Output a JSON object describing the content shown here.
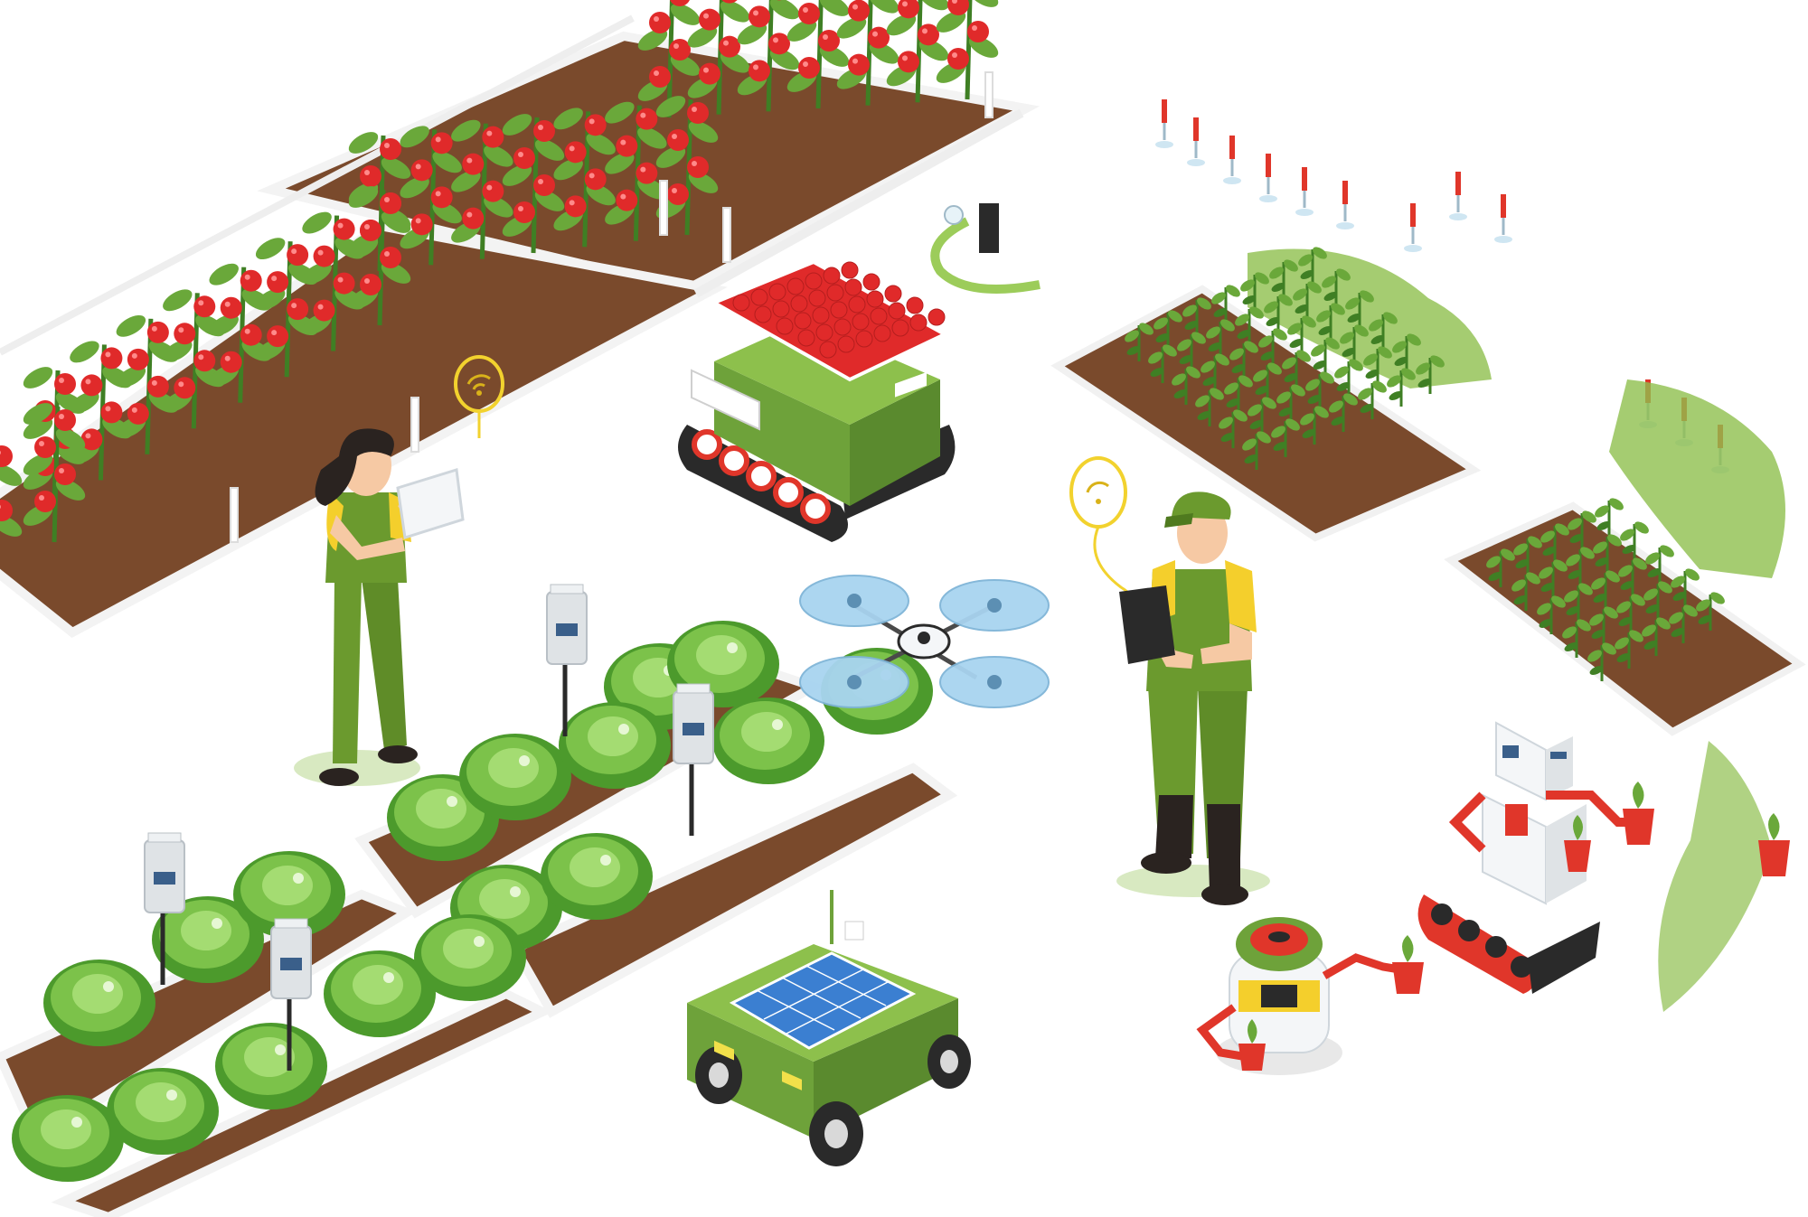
{
  "scene": {
    "subject": "smart-farming-isometric",
    "background_color": "#ffffff"
  },
  "palette": {
    "soil": "#7a4a2c",
    "soil_dark": "#5e3620",
    "bed_edge": "#f3f3f3",
    "leaf": "#6aa83a",
    "leaf_dark": "#3f7f24",
    "tomato": "#e02a2a",
    "tomato_hi": "#ff8a8a",
    "cabbage": "#7cc24a",
    "cabbage_dark": "#4c9a2c",
    "uniform": "#6b9a2e",
    "uniform_dark": "#4f7a1f",
    "shirt": "#f4cf2c",
    "skin": "#f6c9a4",
    "hair": "#2a2320",
    "machine_green": "#6ea23a",
    "machine_dark": "#3c5f1d",
    "robot_red": "#e0362a",
    "robot_white": "#f4f6f8",
    "drone_blue": "#a8d4f0",
    "solar_blue": "#3b7fd1",
    "wifi": "#f2d22e",
    "sensor_gray": "#dfe3e6",
    "sensor_screen": "#3a5f8a"
  },
  "elements": [
    {
      "name": "tomato-greenhouse-beds",
      "icon": "tomato-plant-icon"
    },
    {
      "name": "cabbage-beds-with-sensors",
      "icon": "cabbage-icon"
    },
    {
      "name": "seedling-beds",
      "icon": "seedling-icon"
    },
    {
      "name": "female-farmer-with-tablet",
      "icon": "person-icon"
    },
    {
      "name": "male-farmer-with-tablet",
      "icon": "person-icon"
    },
    {
      "name": "tracked-harvest-robot-with-tomato-crate",
      "icon": "robot-icon"
    },
    {
      "name": "quadcopter-drone",
      "icon": "drone-icon"
    },
    {
      "name": "solar-rover",
      "icon": "solar-panel-icon"
    },
    {
      "name": "planting-robot",
      "icon": "robot-icon"
    },
    {
      "name": "watering-robot",
      "icon": "robot-icon"
    },
    {
      "name": "irrigation-sprinklers",
      "icon": "sprinkler-icon"
    },
    {
      "name": "wifi-signal-markers",
      "icon": "wifi-icon"
    }
  ]
}
